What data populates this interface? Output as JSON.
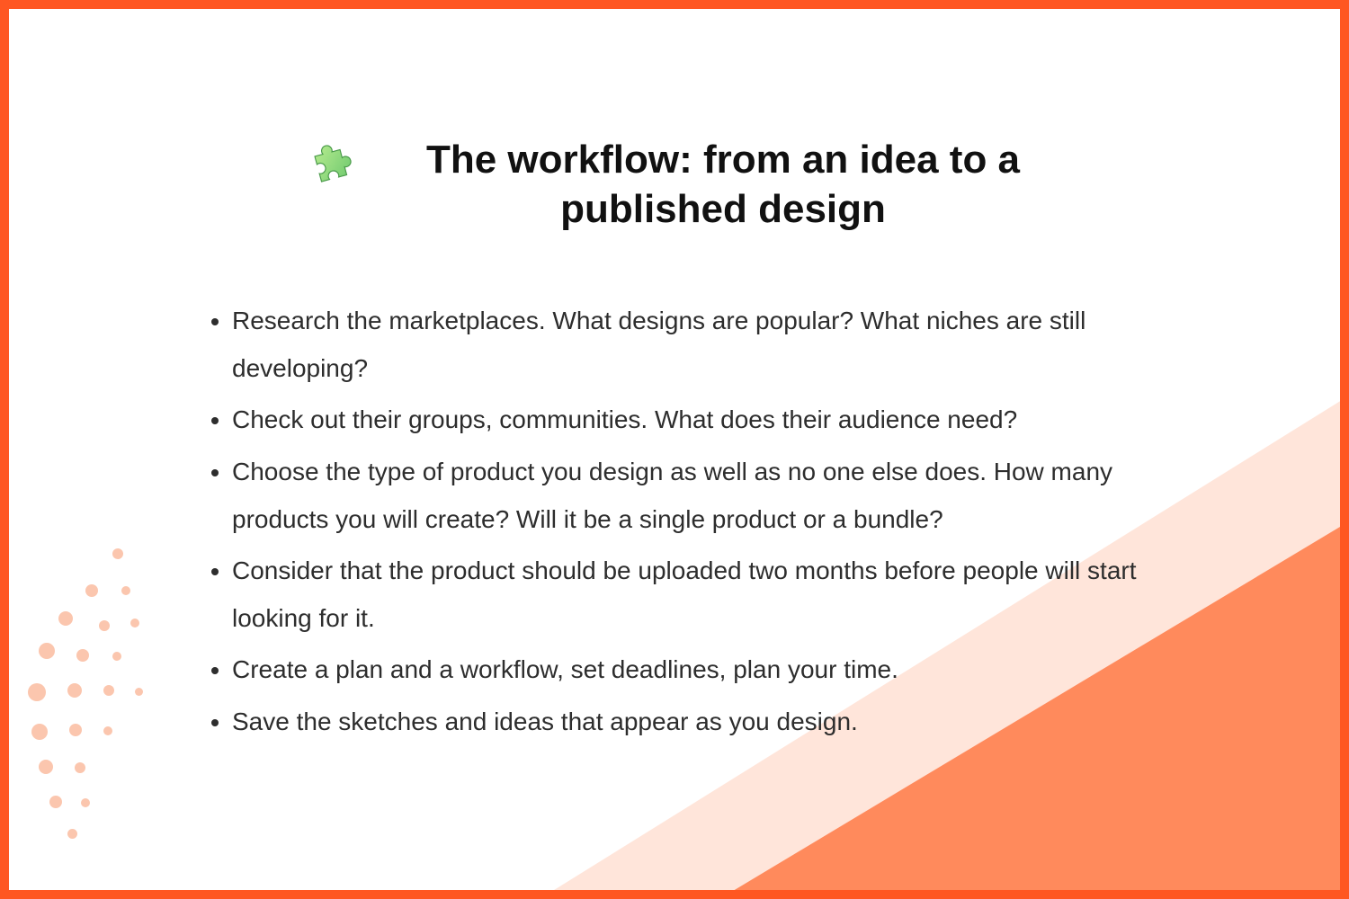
{
  "title": "The workflow: from an idea to a published design",
  "bullets": [
    "Research the marketplaces. What designs are popular? What niches are still developing?",
    "Check out their groups, communities. What does their audience need?",
    "Choose the type of product you design as well as no one else does. How many products you will create? Will it be a single product or a bundle?",
    "Consider that the product should be uploaded two months before people will start looking for it.",
    "Create a plan and a workflow, set deadlines, plan your time.",
    "Save the sketches and ideas that appear as you design."
  ],
  "colors": {
    "border": "#ff5722",
    "accent_light": "#ffe2d6",
    "accent_dark": "#ff8a5c",
    "dot": "#fbc6ae",
    "text": "#2d2d2d"
  },
  "icon": "puzzle-piece-icon"
}
